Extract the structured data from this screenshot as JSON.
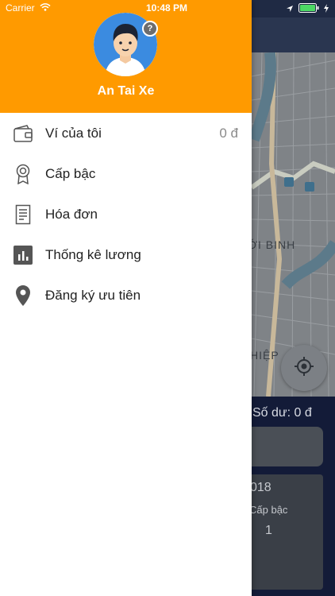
{
  "status_bar": {
    "carrier": "Carrier",
    "time": "10:48 PM"
  },
  "background": {
    "map_labels": [
      "ỚI BINH",
      "HIỆP"
    ],
    "balance_text": "Số dư:  0 đ",
    "stats_year": "018",
    "stats_rank_label": "Cấp bậc",
    "stats_rank_value": "1"
  },
  "drawer": {
    "header_color": "#ff9a00",
    "user_name": "An Tai Xe",
    "help_badge": "?",
    "menu": [
      {
        "label": "Ví của tôi",
        "value": "0 đ",
        "icon": "wallet-icon"
      },
      {
        "label": "Cấp bậc",
        "icon": "rank-badge-icon"
      },
      {
        "label": "Hóa đơn",
        "icon": "invoice-icon"
      },
      {
        "label": "Thống kê lương",
        "icon": "bar-chart-icon"
      },
      {
        "label": "Đăng ký ưu tiên",
        "icon": "location-pin-icon"
      }
    ]
  }
}
